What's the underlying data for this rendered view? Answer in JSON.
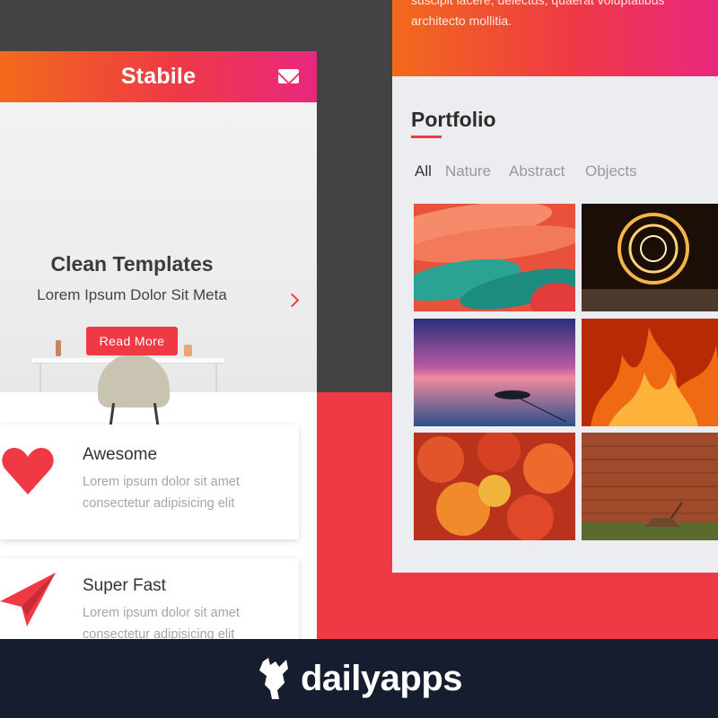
{
  "left_phone": {
    "app_title": "Stabile",
    "hero": {
      "title": "Clean Templates",
      "subtitle": "Lorem Ipsum Dolor Sit Meta",
      "button_label": "Read More"
    },
    "features": [
      {
        "title": "Awesome",
        "line1": "Lorem ipsum dolor sit amet",
        "line2": "consectetur adipisicing elit",
        "icon": "heart-icon"
      },
      {
        "title": "Super Fast",
        "line1": "Lorem ipsum dolor sit amet",
        "line2": "consectetur adipisicing elit",
        "icon": "paper-plane-icon"
      }
    ]
  },
  "right_phone": {
    "top_text": {
      "line1": "suscipit iacere, delectus, quaerat voluptatibus",
      "line2": "architecto mollitia."
    },
    "portfolio_title": "Portfolio",
    "filters": [
      "All",
      "Nature",
      "Abstract",
      "Objects"
    ],
    "active_filter": "All",
    "thumbnails": [
      "kayaks",
      "light-painting",
      "sunset-boat",
      "fire",
      "red-leaves",
      "brick-wall-deer"
    ]
  },
  "footer": {
    "brand": "dailyapps"
  },
  "colors": {
    "accent": "#ef3a45",
    "gradient_start": "#f26a1b",
    "gradient_end": "#e9277f",
    "background_dark": "#434343",
    "footer_bg": "#161d2e"
  }
}
